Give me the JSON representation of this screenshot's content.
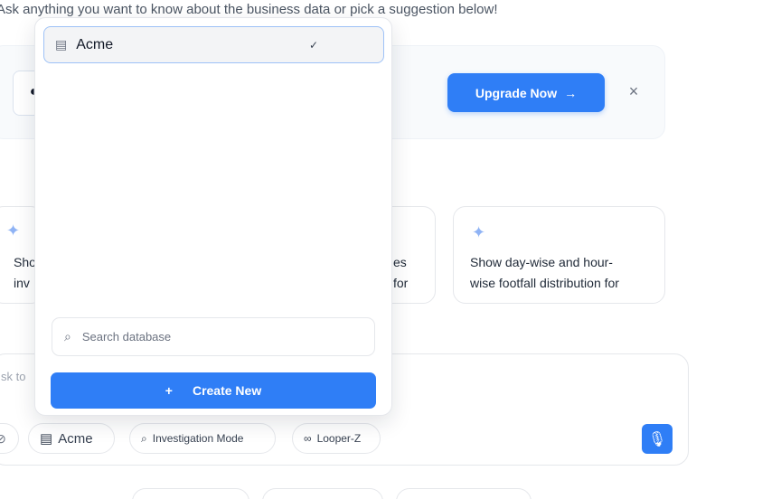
{
  "intro": "Ask anything you want to know about the business data or pick a suggestion below!",
  "banner": {
    "upgrade_label": "Upgrade Now",
    "arrow": "→",
    "close": "×"
  },
  "suggestions": [
    {
      "text_line1": "Sho",
      "text_line2": "inv"
    },
    {
      "text_line1": "es",
      "text_line2": "for"
    },
    {
      "text_line1": "Show day-wise and hour-",
      "text_line2": "wise footfall distribution for"
    }
  ],
  "composer": {
    "placeholder": "sk to",
    "database_chip": "Acme",
    "investigation_chip": "Investigation Mode",
    "looper_chip": "Looper-Z"
  },
  "bottom_chips": [
    "",
    "",
    ""
  ],
  "dropdown": {
    "selected_database": "Acme",
    "search_placeholder": "Search database",
    "create_label": "Create New"
  },
  "colors": {
    "accent": "#2f7ef6",
    "selected_border": "#9ec2f7"
  },
  "icons": {
    "database": "database-icon",
    "search": "search-icon",
    "plus": "plus-icon",
    "mic": "microphone-icon",
    "sparkle": "sparkle-icon",
    "check": "checkmark-icon"
  }
}
